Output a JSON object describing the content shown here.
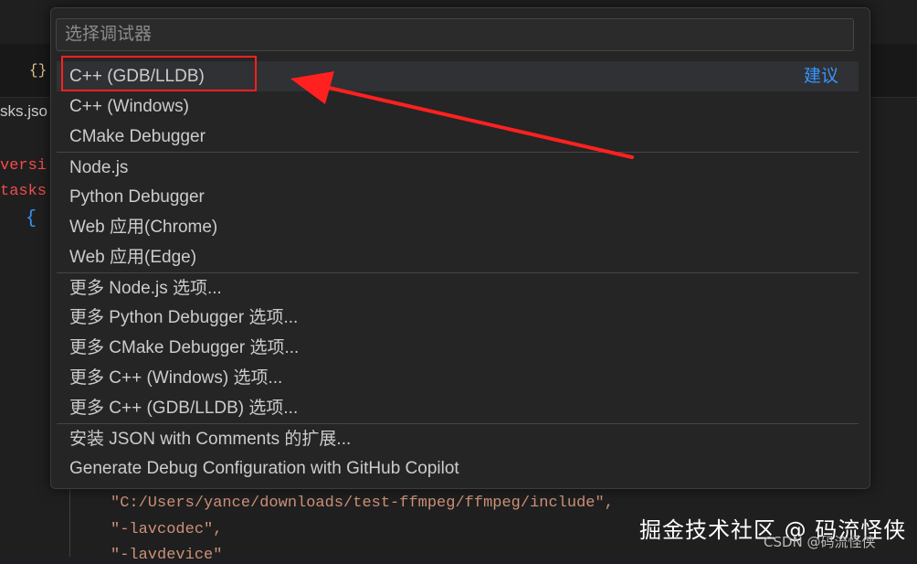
{
  "editor": {
    "tab_icon": "{}",
    "filename_fragment": "sks.jso",
    "line_version_fragment": "versi",
    "line_tasks_fragment": "tasks",
    "open_brace": "{",
    "code_lines": [
      "\"C:/Users/yance/downloads/test-ffmpeg/ffmpeg/include\",",
      "\"-lavcodec\",",
      "\"-lavdevice\""
    ]
  },
  "quick_pick": {
    "placeholder": "选择调试器",
    "input_value": "",
    "items": [
      {
        "label": "C++ (GDB/LLDB)",
        "hint": "建议"
      },
      {
        "label": "C++ (Windows)"
      },
      {
        "label": "CMake Debugger"
      },
      {
        "label": "Node.js"
      },
      {
        "label": "Python Debugger"
      },
      {
        "label": "Web 应用(Chrome)"
      },
      {
        "label": "Web 应用(Edge)"
      },
      {
        "label": "更多 Node.js 选项..."
      },
      {
        "label": "更多 Python Debugger 选项..."
      },
      {
        "label": "更多 CMake Debugger 选项..."
      },
      {
        "label": "更多 C++ (Windows) 选项..."
      },
      {
        "label": "更多 C++ (GDB/LLDB) 选项..."
      },
      {
        "label": "安装 JSON with Comments 的扩展..."
      },
      {
        "label": "Generate Debug Configuration with GitHub Copilot"
      }
    ]
  },
  "watermark": {
    "main": "掘金技术社区 @ 码流怪侠",
    "sub": "CSDN @码流怪侠"
  },
  "colors": {
    "annotation": "#ff2020",
    "accent": "#3794ff"
  }
}
